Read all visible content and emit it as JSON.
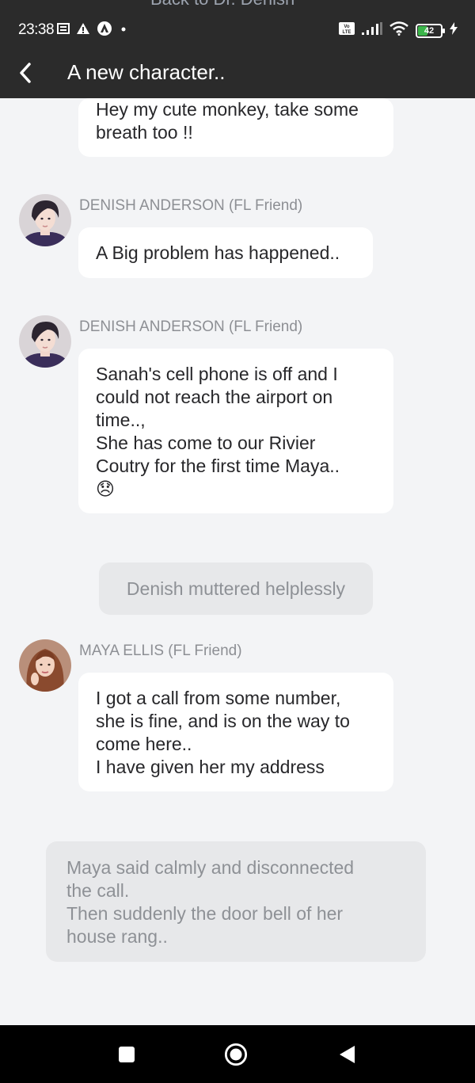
{
  "status_bar": {
    "time": "23:38",
    "battery_level": "42",
    "network_label": "Vo LTE",
    "left_icons": [
      "notes-icon",
      "warning-icon",
      "app-icon",
      "dot-icon"
    ],
    "right_icons": [
      "volte-icon",
      "signal-icon",
      "wifi-icon",
      "battery-icon",
      "charging-icon"
    ]
  },
  "header": {
    "title": "A new character..",
    "ghost_back_text": "Back to Dr. Denish",
    "ghost_sender": "DENISH ANDERSON (FL Friend)"
  },
  "messages": [
    {
      "sender": "",
      "lines": [
        "Hey my cute monkey, take some",
        "breath too !!"
      ]
    },
    {
      "sender": "DENISH ANDERSON (FL Friend)",
      "lines": [
        "A Big problem has happened.."
      ]
    },
    {
      "sender": "DENISH ANDERSON (FL Friend)",
      "lines": [
        "Sanah's cell phone is off and I",
        "could not reach the airport on",
        "time..,",
        "She has come to our Rivier",
        "Coutry for the first time Maya..",
        "😞"
      ]
    },
    {
      "sender": "MAYA ELLIS (FL Friend)",
      "lines": [
        "I got a call from some number,",
        "she is fine, and is on the way to",
        "come here..",
        "I have given her my address"
      ]
    }
  ],
  "narrations": [
    {
      "lines": [
        "Denish muttered helplessly"
      ]
    },
    {
      "lines": [
        "Maya said calmly and disconnected",
        "the call.",
        "Then suddenly the door bell of her",
        "house rang.."
      ]
    }
  ],
  "colors": {
    "bar": "#2b2b2b",
    "background": "#f3f4f6",
    "bubble": "#ffffff",
    "narration": "#e7e8ea",
    "battery": "#3bb54a"
  }
}
